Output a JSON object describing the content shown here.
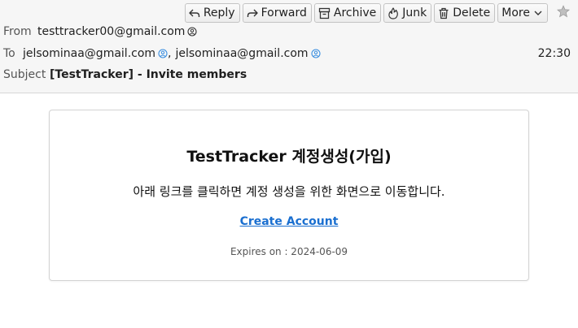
{
  "toolbar": {
    "reply_label": "Reply",
    "forward_label": "Forward",
    "archive_label": "Archive",
    "junk_label": "Junk",
    "delete_label": "Delete",
    "more_label": "More"
  },
  "header": {
    "from_label": "From",
    "from_address": "testtracker00@gmail.com",
    "to_label": "To",
    "to_addresses": [
      "jelsominaa@gmail.com",
      "jelsominaa@gmail.com"
    ],
    "to_separator": ",",
    "time": "22:30",
    "subject_label": "Subject",
    "subject": "[TestTracker] - Invite members"
  },
  "message": {
    "title": "TestTracker 계정생성(가입)",
    "description": "아래 링크를 클릭하면 계정 생성을 위한 화면으로 이동합니다.",
    "link_label": "Create Account",
    "expires": "Expires on : 2024-06-09"
  },
  "colors": {
    "header_bg": "#f6f6f6",
    "link": "#1a6fd0",
    "contact_icon": "#3b8fe0"
  }
}
